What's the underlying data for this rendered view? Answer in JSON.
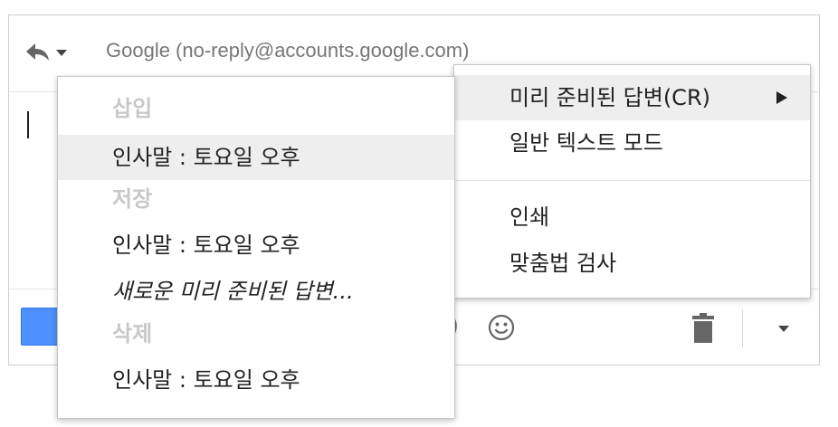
{
  "header": {
    "recipient": "Google (no-reply@accounts.google.com)"
  },
  "icons": {
    "reply": "reply-icon",
    "dropdown": "caret-down-icon",
    "emoji": "smiley-icon",
    "trash": "trash-icon",
    "more": "caret-down-icon"
  },
  "colors": {
    "send_button": "#4d90fe",
    "highlight": "#eeeeee",
    "section_label": "#c8c8c8",
    "recipient_text": "#777777"
  },
  "right_menu": {
    "items": [
      {
        "label": "미리 준비된 답변(CR)",
        "highlighted": true,
        "has_submenu": true
      },
      {
        "label": "일반 텍스트 모드"
      },
      {
        "label": "인쇄"
      },
      {
        "label": "맞춤법 검사"
      }
    ]
  },
  "left_menu": {
    "insert_section": "삽입",
    "insert_items": [
      {
        "label": "인사말 : 토요일 오후",
        "highlighted": true
      }
    ],
    "save_section": "저장",
    "save_items": [
      {
        "label": "인사말 : 토요일 오후"
      },
      {
        "label": "새로운 미리 준비된 답변..."
      }
    ],
    "delete_section": "삭제",
    "delete_items": [
      {
        "label": "인사말 : 토요일 오후"
      }
    ]
  }
}
